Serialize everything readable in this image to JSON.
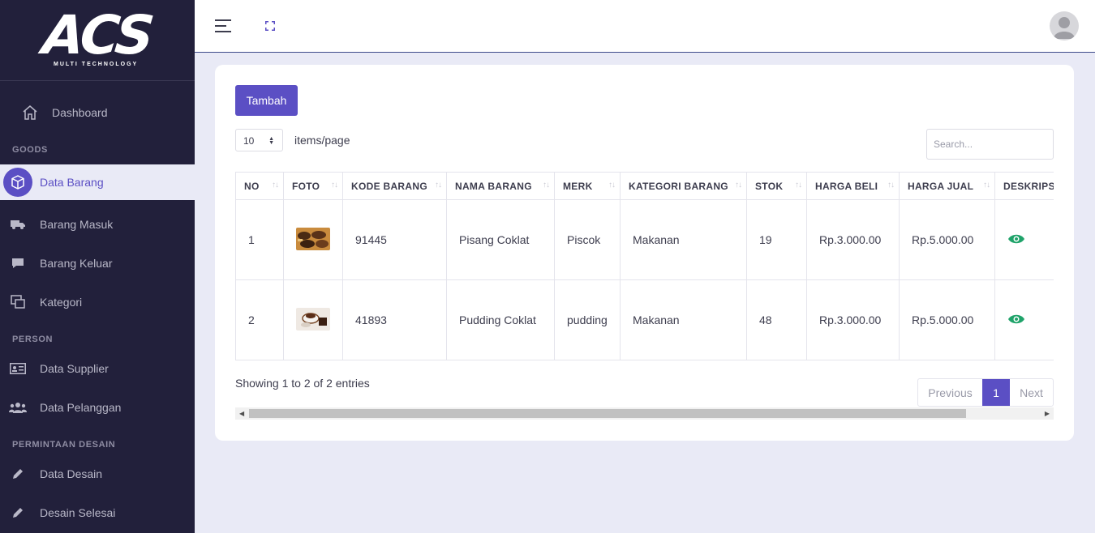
{
  "brand": {
    "logo": "ACS",
    "tagline": "MULTI TECHNOLOGY"
  },
  "sidebar": {
    "dashboard": "Dashboard",
    "section_goods": "GOODS",
    "data_barang": "Data Barang",
    "barang_masuk": "Barang Masuk",
    "barang_keluar": "Barang Keluar",
    "kategori": "Kategori",
    "section_person": "PERSON",
    "data_supplier": "Data Supplier",
    "data_pelanggan": "Data Pelanggan",
    "section_permintaan": "PERMINTAAN DESAIN",
    "data_desain": "Data Desain",
    "desain_selesai": "Desain Selesai"
  },
  "toolbar": {
    "add_label": "Tambah"
  },
  "pagesize": {
    "value": "10",
    "label": "items/page"
  },
  "search": {
    "placeholder": "Search..."
  },
  "table": {
    "headers": [
      "NO",
      "FOTO",
      "KODE BARANG",
      "NAMA BARANG",
      "MERK",
      "KATEGORI BARANG",
      "STOK",
      "HARGA BELI",
      "HARGA JUAL",
      "DESKRIPSI"
    ],
    "rows": [
      {
        "no": "1",
        "kode": "91445",
        "nama": "Pisang Coklat",
        "merk": "Piscok",
        "kategori": "Makanan",
        "stok": "19",
        "beli": "Rp.3.000.00",
        "jual": "Rp.5.000.00"
      },
      {
        "no": "2",
        "kode": "41893",
        "nama": "Pudding Coklat",
        "merk": "pudding",
        "kategori": "Makanan",
        "stok": "48",
        "beli": "Rp.3.000.00",
        "jual": "Rp.5.000.00"
      }
    ]
  },
  "footer": {
    "showing": "Showing 1 to 2 of 2 entries"
  },
  "pager": {
    "previous": "Previous",
    "current": "1",
    "next": "Next"
  },
  "colors": {
    "sidebar_bg": "#22203b",
    "accent": "#5b4fc4",
    "page_bg": "#e9eaf6",
    "eye": "#1fa36a"
  }
}
